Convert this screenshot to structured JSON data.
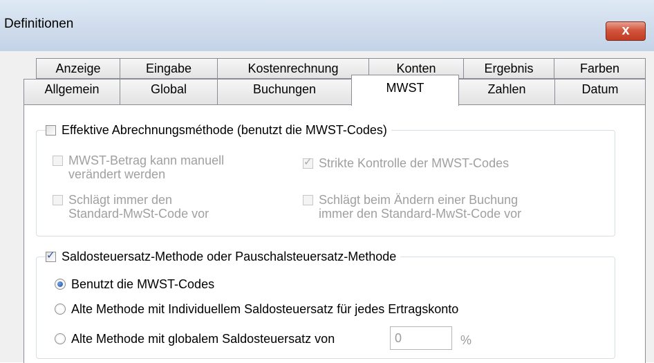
{
  "window": {
    "title": "Definitionen",
    "close_label": "x"
  },
  "tabs_row1": [
    "Anzeige",
    "Eingabe",
    "Kostenrechnung",
    "Konten",
    "Ergebnis",
    "Farben"
  ],
  "tabs_row2": [
    "Allgemein",
    "Global",
    "Buchungen",
    "MWST",
    "Zahlen",
    "Datum"
  ],
  "active_tab": "MWST",
  "group1": {
    "label": "Effektive Abrechnungsméthode (benutzt die MWST-Codes)",
    "checked": false,
    "options": [
      {
        "line1": "MWST-Betrag kann manuell",
        "line2": "verändert werden",
        "checked": false,
        "enabled": false
      },
      {
        "line1": "Strikte Kontrolle der MWST-Codes",
        "line2": "",
        "checked": true,
        "enabled": false
      },
      {
        "line1": "Schlägt immer den",
        "line2": "Standard-MwSt-Code vor",
        "checked": false,
        "enabled": false
      },
      {
        "line1": "Schlägt beim Ändern einer Buchung",
        "line2": "immer den Standard-MwSt-Code vor",
        "checked": false,
        "enabled": false
      }
    ]
  },
  "group2": {
    "label": "Saldosteuersatz-Methode oder Pauschalsteuersatz-Methode",
    "checked": true,
    "radios": [
      {
        "label": "Benutzt die MWST-Codes",
        "selected": true
      },
      {
        "label": "Alte Methode mit Individuellem Saldosteuersatz für jedes Ertragskonto",
        "selected": false
      },
      {
        "label": "Alte Methode mit globalem Saldosteuersatz von",
        "selected": false
      }
    ],
    "rate_value": "0",
    "rate_unit": "%"
  }
}
